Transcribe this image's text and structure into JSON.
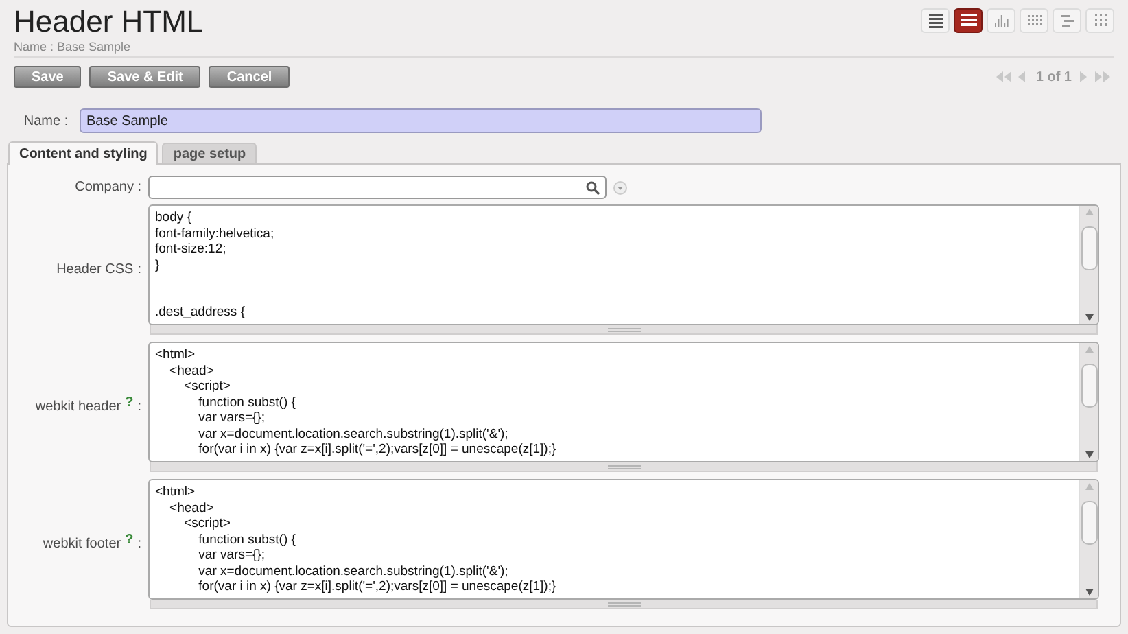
{
  "title": "Header HTML",
  "breadcrumb": "Name : Base Sample",
  "view_switcher": [
    {
      "kind": "list",
      "selected": false
    },
    {
      "kind": "form",
      "selected": true
    },
    {
      "kind": "graph",
      "selected": false
    },
    {
      "kind": "calendar",
      "selected": false
    },
    {
      "kind": "gantt",
      "selected": false
    },
    {
      "kind": "kanban",
      "selected": false
    }
  ],
  "buttons": [
    "Save",
    "Save & Edit",
    "Cancel"
  ],
  "pager": "1 of 1",
  "name_field": {
    "label": "Name :",
    "value": "Base Sample"
  },
  "tabs": [
    {
      "label": "Content and styling",
      "selected": true
    },
    {
      "label": "page setup",
      "selected": false
    }
  ],
  "company_field": {
    "label": "Company :"
  },
  "code_fields": [
    {
      "label": "Header CSS",
      "colon": ":",
      "lines": [
        "body {",
        "font-family:helvetica;",
        "font-size:12;",
        "}"
      ],
      "lines_after_gap": [
        ".dest_address {"
      ]
    },
    {
      "label": "webkit header",
      "help": "?",
      "colon": ":",
      "lines": [
        "<html>",
        "    <head>",
        "        <script>",
        "            function subst() {",
        "            var vars={};",
        "            var x=document.location.search.substring(1).split('&');",
        "            for(var i in x) {var z=x[i].split('=',2);vars[z[0]] = unescape(z[1]);}"
      ]
    },
    {
      "label": "webkit footer",
      "help": "?",
      "colon": ":",
      "lines": [
        "<html>",
        "    <head>",
        "        <script>",
        "            function subst() {",
        "            var vars={};",
        "            var x=document.location.search.substring(1).split('&');",
        "            for(var i in x) {var z=x[i].split('=',2);vars[z[0]] = unescape(z[1]);}"
      ]
    }
  ]
}
